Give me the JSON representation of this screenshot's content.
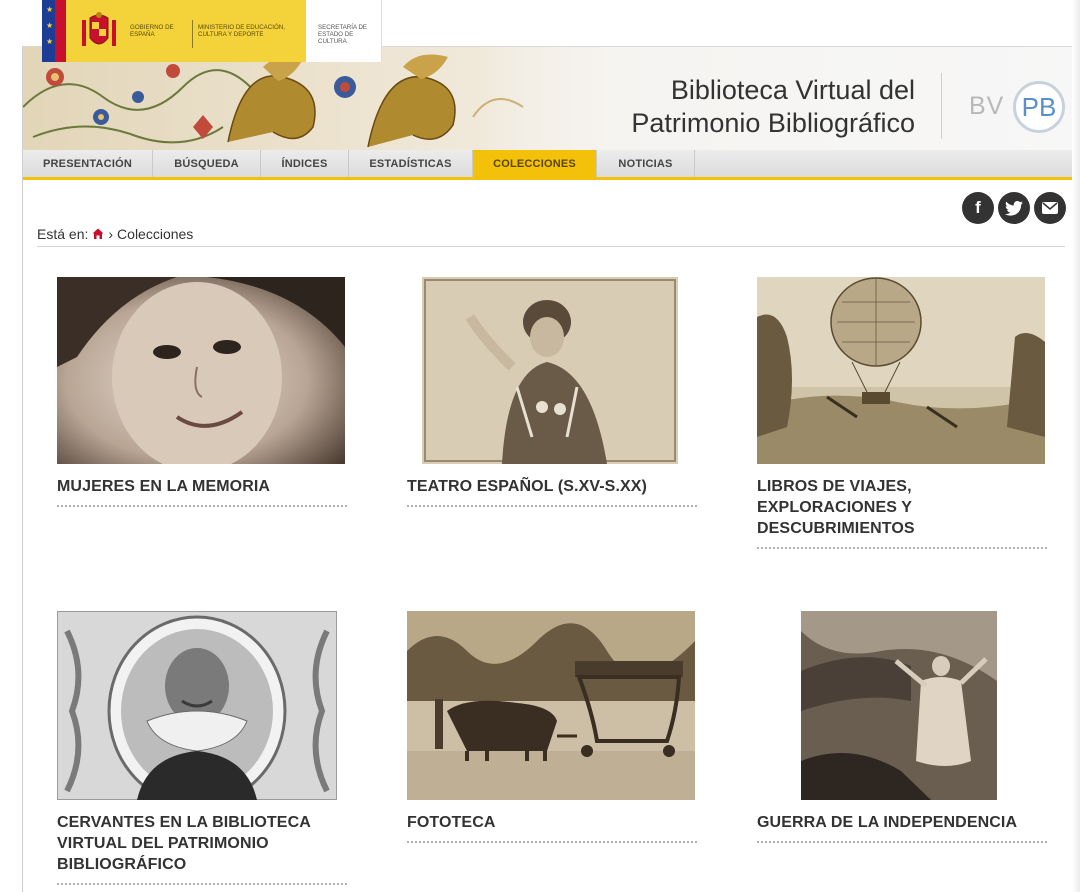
{
  "gov": {
    "line1": "GOBIERNO DE ESPAÑA",
    "line2": "MINISTERIO DE EDUCACIÓN, CULTURA Y DEPORTE",
    "line3": "SECRETARÍA DE ESTADO DE CULTURA"
  },
  "header": {
    "title_line1": "Biblioteca Virtual del",
    "title_line2": "Patrimonio Bibliográfico",
    "logo_bv": "BV",
    "logo_pb": "PB"
  },
  "nav": {
    "items": [
      {
        "label": "PRESENTACIÓN"
      },
      {
        "label": "BÚSQUEDA"
      },
      {
        "label": "ÍNDICES"
      },
      {
        "label": "ESTADÍSTICAS"
      },
      {
        "label": "COLECCIONES",
        "active": true
      },
      {
        "label": "NOTICIAS"
      }
    ]
  },
  "social": {
    "facebook": "f",
    "twitter_icon": "twitter-icon",
    "email_icon": "email-icon"
  },
  "breadcrumb": {
    "prefix": "Está en:",
    "separator": "›",
    "current": "Colecciones"
  },
  "collections": [
    {
      "title": "MUJERES EN LA MEMORIA"
    },
    {
      "title": "TEATRO ESPAÑOL (S.XV-S.XX)"
    },
    {
      "title": "LIBROS DE VIAJES, EXPLORACIONES Y DESCUBRIMIENTOS"
    },
    {
      "title": "CERVANTES EN LA BIBLIOTECA VIRTUAL DEL PATRIMONIO BIBLIOGRÁFICO"
    },
    {
      "title": "FOTOTECA"
    },
    {
      "title": "GUERRA DE LA INDEPENDENCIA"
    }
  ],
  "colors": {
    "nav_active": "#f4c10a",
    "gov_yellow": "#f4d23a",
    "text": "#333333"
  }
}
